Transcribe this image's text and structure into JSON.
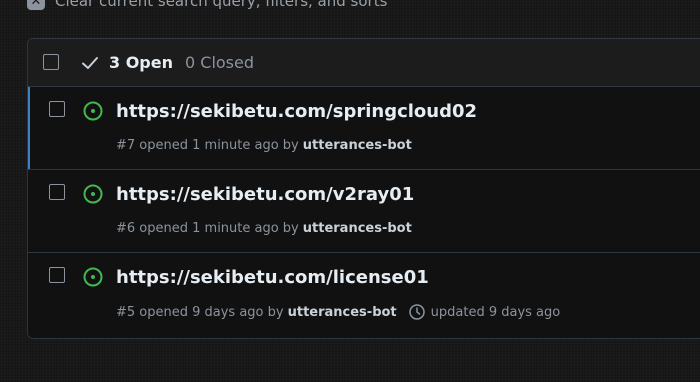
{
  "clear_bar": {
    "label": "Clear current search query, filters, and sorts"
  },
  "header": {
    "open_label": "3 Open",
    "closed_label": "0 Closed"
  },
  "issues": [
    {
      "title": "https://sekibetu.com/springcloud02",
      "meta_prefix": "#7 opened 1 minute ago by",
      "author": "utterances-bot"
    },
    {
      "title": "https://sekibetu.com/v2ray01",
      "meta_prefix": "#6 opened 1 minute ago by",
      "author": "utterances-bot"
    },
    {
      "title": "https://sekibetu.com/license01",
      "meta_prefix": "#5 opened 9 days ago by",
      "author": "utterances-bot",
      "updated": "updated 9 days ago"
    }
  ],
  "colors": {
    "open_issue": "#3fb950",
    "accent": "#3b82c4"
  },
  "icons": {
    "check": "check-icon",
    "issue": "issue-opened-icon",
    "clock": "clock-icon",
    "clear": "x-icon"
  }
}
